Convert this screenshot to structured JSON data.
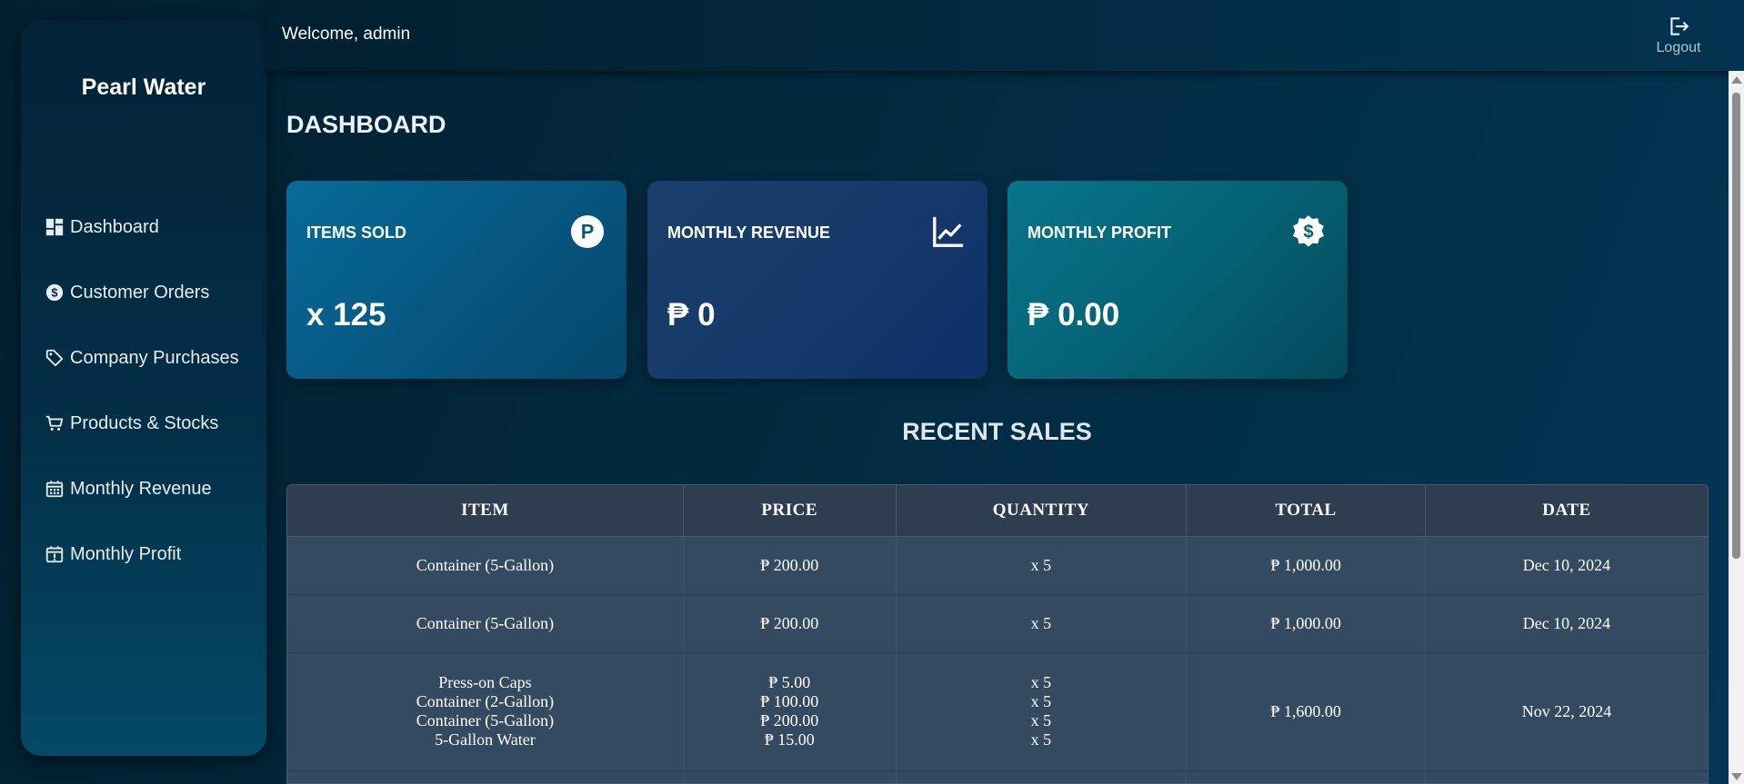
{
  "sidebar": {
    "brand": "Pearl Water",
    "items": [
      {
        "label": "Dashboard",
        "icon": "dashboard-icon"
      },
      {
        "label": "Customer Orders",
        "icon": "dollar-circle-icon"
      },
      {
        "label": "Company Purchases",
        "icon": "tag-icon"
      },
      {
        "label": "Products & Stocks",
        "icon": "cart-icon"
      },
      {
        "label": "Monthly Revenue",
        "icon": "calendar-icon"
      },
      {
        "label": "Monthly Profit",
        "icon": "calendar-alert-icon"
      }
    ]
  },
  "header": {
    "welcome": "Welcome, admin",
    "logout_label": "Logout"
  },
  "main": {
    "title": "DASHBOARD",
    "cards": [
      {
        "label": "ITEMS SOLD",
        "value": "x 125",
        "icon": "peso-circle-icon"
      },
      {
        "label": "MONTHLY REVENUE",
        "value": "₱ 0",
        "icon": "line-chart-icon"
      },
      {
        "label": "MONTHLY PROFIT",
        "value": "₱ 0.00",
        "icon": "dollar-badge-icon"
      }
    ],
    "recent_sales": {
      "title": "RECENT SALES",
      "columns": [
        "ITEM",
        "PRICE",
        "QUANTITY",
        "TOTAL",
        "DATE"
      ],
      "rows": [
        {
          "items": [
            "Container (5-Gallon)"
          ],
          "prices": [
            "₱ 200.00"
          ],
          "quantities": [
            "x 5"
          ],
          "total": "₱ 1,000.00",
          "date": "Dec 10, 2024"
        },
        {
          "items": [
            "Container (5-Gallon)"
          ],
          "prices": [
            "₱ 200.00"
          ],
          "quantities": [
            "x 5"
          ],
          "total": "₱ 1,000.00",
          "date": "Dec 10, 2024"
        },
        {
          "items": [
            "Press-on Caps",
            "Container (2-Gallon)",
            "Container (5-Gallon)",
            "5-Gallon Water"
          ],
          "prices": [
            "₱ 5.00",
            "₱ 100.00",
            "₱ 200.00",
            "₱ 15.00"
          ],
          "quantities": [
            "x 5",
            "x 5",
            "x 5",
            "x 5"
          ],
          "total": "₱ 1,600.00",
          "date": "Nov 22, 2024"
        }
      ]
    }
  },
  "colors": {
    "card_items_sold": "#076b99",
    "card_revenue": "#1b3f6b",
    "card_profit": "#07758c",
    "table_header": "#2e3d50",
    "table_row": "#344a60"
  }
}
